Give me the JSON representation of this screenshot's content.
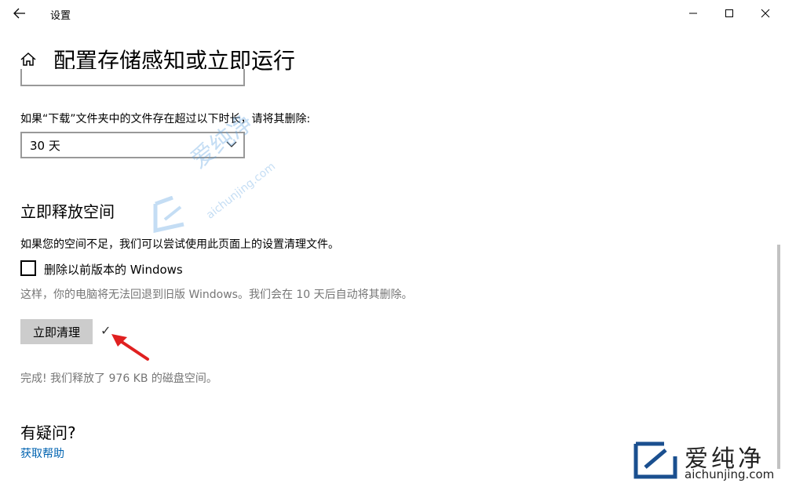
{
  "window": {
    "title": "设置",
    "controls": [
      "minimize-icon",
      "maximize-icon",
      "close-icon"
    ]
  },
  "header": {
    "home_icon": "home-icon",
    "title": "配置存储感知或立即运行"
  },
  "downloads": {
    "label": "如果“下载”文件夹中的文件存在超过以下时长，请将其删除:",
    "selected": "30 天"
  },
  "free_space": {
    "title": "立即释放空间",
    "description": "如果您的空间不足，我们可以尝试使用此页面上的设置清理文件。",
    "checkbox_label": "删除以前版本的 Windows",
    "checkbox_checked": false,
    "note": "这样，你的电脑将无法回退到旧版 Windows。我们会在 10 天后自动将其删除。",
    "button_label": "立即清理",
    "check_mark": "✓",
    "result": "完成! 我们释放了 976 KB 的磁盘空间。"
  },
  "help": {
    "title": "有疑问?",
    "link": "获取帮助"
  },
  "watermark": {
    "text": "爱纯净",
    "url": "aichunjing.com"
  },
  "logo": {
    "text": "爱纯净",
    "url": "aichunjing.com"
  },
  "colors": {
    "accent": "#0063b1",
    "button_bg": "#cccccc",
    "muted_text": "#767676",
    "annotation_arrow": "#e02020"
  }
}
